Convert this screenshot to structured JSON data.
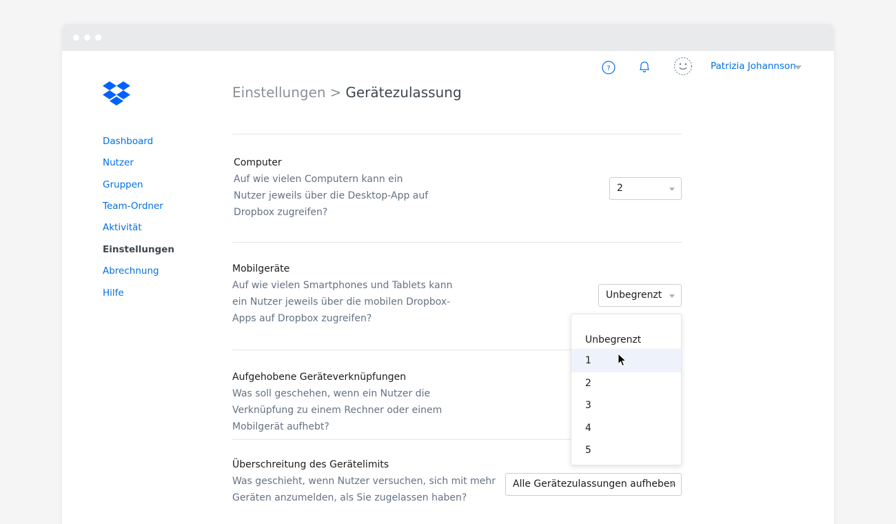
{
  "header": {
    "help_icon": "help-icon",
    "bell_icon": "bell-icon",
    "avatar_icon": "avatar-icon",
    "user_name": "Patrizia Johannson"
  },
  "logo": "dropbox-logo",
  "sidebar": {
    "items": [
      {
        "label": "Dashboard"
      },
      {
        "label": "Nutzer"
      },
      {
        "label": "Gruppen"
      },
      {
        "label": "Team-Ordner"
      },
      {
        "label": "Aktivität"
      },
      {
        "label": "Einstellungen",
        "active": true
      },
      {
        "label": "Abrechnung"
      },
      {
        "label": "Hilfe"
      }
    ]
  },
  "breadcrumb": {
    "parent": "Einstellungen",
    "separator": ">",
    "current": "Gerätezulassung"
  },
  "sections": {
    "computer": {
      "title": "Computer",
      "desc_lines": [
        "Auf wie vielen Computern kann ein",
        "Nutzer jeweils über die Desktop-App auf",
        "Dropbox zugreifen?"
      ],
      "select_value": "2"
    },
    "mobile": {
      "title": "Mobilgeräte",
      "desc_lines": [
        "Auf wie vielen Smartphones und Tablets kann",
        "ein Nutzer jeweils über die mobilen Dropbox-",
        "Apps auf Dropbox zugreifen?"
      ],
      "select_value": "Unbegrenzt",
      "dropdown_options": [
        "Unbegrenzt",
        "1",
        "2",
        "3",
        "4",
        "5"
      ],
      "hovered_option": "1"
    },
    "unlinked": {
      "title": "Aufgehobene Geräteverknüpfungen",
      "desc_lines": [
        "Was soll geschehen, wenn ein Nutzer die",
        "Verknüpfung zu einem Rechner oder einem",
        "Mobilgerät aufhebt?"
      ]
    },
    "limit": {
      "title": "Überschreitung des Gerätelimits",
      "desc_lines": [
        "Was geschieht, wenn Nutzer versuchen, sich mit mehr",
        "Geräten anzumelden, als Sie zugelassen haben?"
      ],
      "select_value": "Alle Gerätezulassungen aufheben"
    }
  },
  "colors": {
    "link": "#0070e0",
    "text": "#1e1919",
    "muted": "#637282",
    "hover": "#eef3fb"
  }
}
